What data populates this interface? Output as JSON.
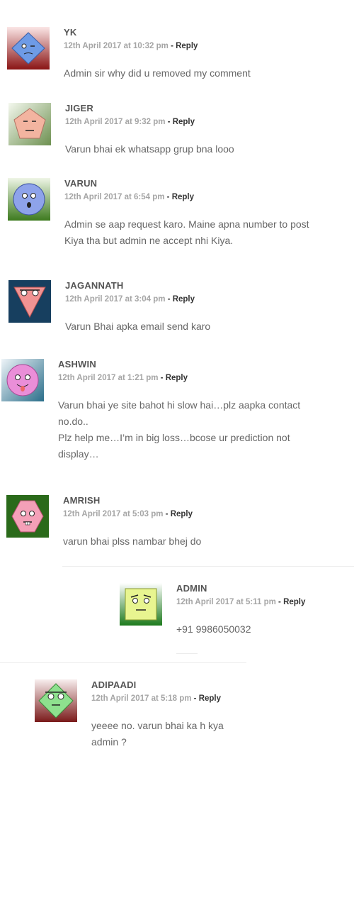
{
  "comments": [
    {
      "author": "YK",
      "date": "12th April 2017 at 10:32 pm",
      "reply": "Reply",
      "lines": [
        "Admin sir why did u removed my comment"
      ]
    },
    {
      "author": "JIGER",
      "date": "12th April 2017 at 9:32 pm",
      "reply": "Reply",
      "lines": [
        "Varun bhai ek whatsapp grup bna looo"
      ]
    },
    {
      "author": "VARUN",
      "date": "12th April 2017 at 6:54 pm",
      "reply": "Reply",
      "lines": [
        "Admin se aap request karo. Maine apna number to post",
        "Kiya tha but admin ne accept nhi Kiya."
      ]
    },
    {
      "author": "JAGANNATH",
      "date": "12th April 2017 at 3:04 pm",
      "reply": "Reply",
      "lines": [
        "Varun Bhai apka email send karo"
      ]
    },
    {
      "author": "ASHWIN",
      "date": "12th April 2017 at 1:21 pm",
      "reply": "Reply",
      "lines": [
        "Varun bhai ye site bahot hi slow hai…plz aapka contact",
        "no.do..",
        "Plz help me…I’m in big loss…bcose ur prediction not",
        "display…"
      ]
    },
    {
      "author": "AMRISH",
      "date": "12th April 2017 at 5:03 pm",
      "reply": "Reply",
      "lines": [
        "varun bhai plss nambar bhej do"
      ]
    },
    {
      "author": "ADMIN",
      "date": "12th April 2017 at 5:11 pm",
      "reply": "Reply",
      "lines": [
        "+91 9986050032"
      ]
    },
    {
      "author": "ADIPAADI",
      "date": "12th April 2017 at 5:18 pm",
      "reply": "Reply",
      "lines": [
        "yeeee no. varun bhai ka h kya",
        "admin ?"
      ]
    }
  ],
  "separator": " - "
}
